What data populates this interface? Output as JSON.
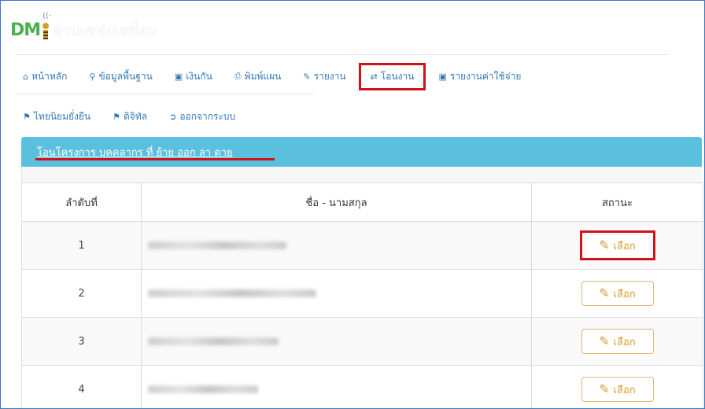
{
  "logo": {
    "brand": "DM",
    "subtitle": "อำเภอทุ่งเสลี่ยม"
  },
  "nav": {
    "row1": [
      {
        "icon": "home-icon",
        "label": "หน้าหลัก"
      },
      {
        "icon": "map-marker-icon",
        "label": "ข้อมูลพื้นฐาน"
      },
      {
        "icon": "money-icon",
        "label": "เงินกัน"
      },
      {
        "icon": "print-icon",
        "label": "พิมพ์แผน"
      },
      {
        "icon": "pencil-icon",
        "label": "รายงาน"
      },
      {
        "icon": "transfer-icon",
        "label": "โอนงาน"
      },
      {
        "icon": "money-icon",
        "label": "รายงานค่าใช้จ่าย"
      }
    ],
    "row2": [
      {
        "icon": "flag-icon",
        "label": "ไทยนิยมยั่งยืน"
      },
      {
        "icon": "flag-icon",
        "label": "ดิจิทัล"
      },
      {
        "icon": "logout-icon",
        "label": "ออกจากระบบ"
      }
    ],
    "active": "โอนงาน"
  },
  "panel": {
    "title": "โอนโครงการ บุคคลากร ที่ ย้าย ออก ลา ตาย"
  },
  "table": {
    "headers": [
      "ลำดับที่",
      "ชื่อ - นามสกุล",
      "สถานะ"
    ],
    "rows": [
      {
        "no": "1",
        "select_label": "เลือก"
      },
      {
        "no": "2",
        "select_label": "เลือก"
      },
      {
        "no": "3",
        "select_label": "เลือก"
      },
      {
        "no": "4",
        "select_label": "เลือก"
      }
    ]
  },
  "colors": {
    "accent": "#337ab7",
    "panel": "#5bc0de",
    "highlight": "#d0131b",
    "warning": "#d99a2b"
  }
}
